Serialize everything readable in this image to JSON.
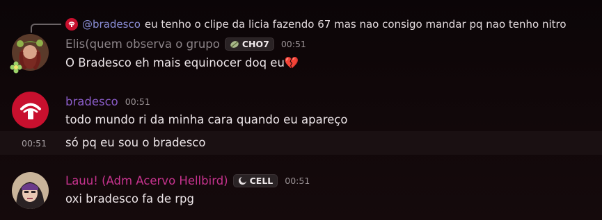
{
  "reply": {
    "mention": "@bradesco",
    "text": "eu tenho o clipe da licia fazendo 67 mas nao consigo mandar pq nao tenho nitro"
  },
  "messages": [
    {
      "author": "Elis(quem observa o grupo",
      "author_color": "#8c8488",
      "tag": "CHO7",
      "time": "00:51",
      "lines": [
        "O Bradesco eh mais equinocer doq eu💔"
      ]
    },
    {
      "author": "bradesco",
      "author_color": "#8a5cc8",
      "time": "00:51",
      "lines": [
        "todo mundo ri da minha cara quando eu apareço"
      ]
    },
    {
      "side_time": "00:51",
      "lines": [
        "só pq eu sou o bradesco"
      ]
    },
    {
      "author": "Lauu! (Adm Acervo Hellbird)",
      "author_color": "#c8338f",
      "tag": "CELL",
      "time": "00:51",
      "lines": [
        "oxi bradesco fa de rpg"
      ]
    }
  ],
  "colors": {
    "bradesco_red": "#c8102e",
    "mention": "#8b8fd8"
  }
}
